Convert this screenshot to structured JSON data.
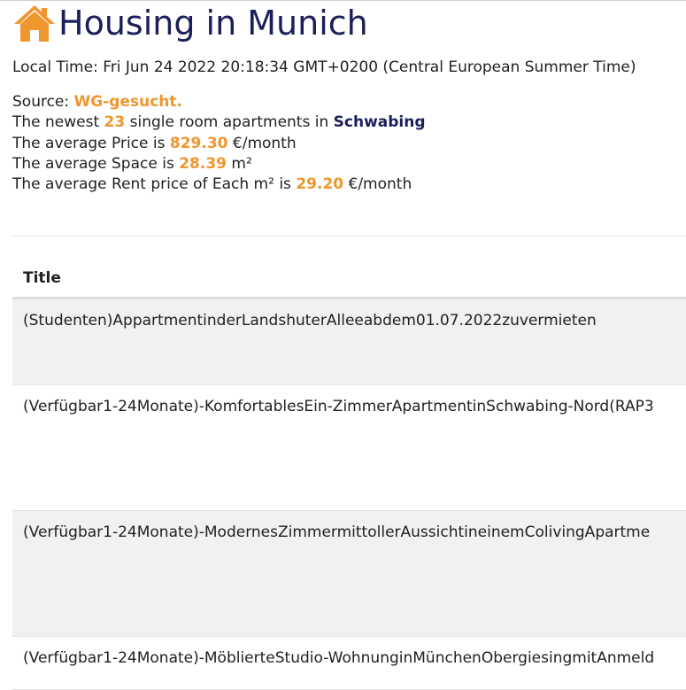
{
  "header": {
    "title": "Housing in Munich",
    "icon": "home-icon",
    "icon_color": "#f0962e",
    "title_color": "#1a1f5c"
  },
  "local_time": "Local Time: Fri Jun 24 2022 20:18:34 GMT+0200 (Central European Summer Time)",
  "source": {
    "label": "Source: ",
    "name": "WG-gesucht."
  },
  "stats": {
    "newest_prefix": "The newest ",
    "count": "23",
    "newest_middle": " single room apartments in ",
    "district": "Schwabing",
    "avg_price_prefix": "The average Price is ",
    "avg_price": "829.30",
    "avg_price_unit": " €/month",
    "avg_space_prefix": "The average Space is ",
    "avg_space": "28.39",
    "avg_space_unit": " m²",
    "avg_rent_prefix": "The average Rent price of Each m² is ",
    "avg_rent": "29.20",
    "avg_rent_unit": " €/month"
  },
  "colors": {
    "accent": "#f0962e",
    "navy": "#1a1f5c"
  },
  "table": {
    "headers": [
      "Title"
    ],
    "rows": [
      {
        "title": "(Studenten)AppartmentinderLandshuterAlleeabdem01.07.2022zuvermieten"
      },
      {
        "title": "(Verfügbar1-24Monate)-KomfortablesEin-ZimmerApartmentinSchwabing-Nord(RAP3"
      },
      {
        "title": "(Verfügbar1-24Monate)-ModernesZimmermittollerAussichtineinemColivingApartme"
      },
      {
        "title": "(Verfügbar1-24Monate)-MöblierteStudio-WohnunginMünchenObergiesingmitAnmeld"
      }
    ]
  }
}
